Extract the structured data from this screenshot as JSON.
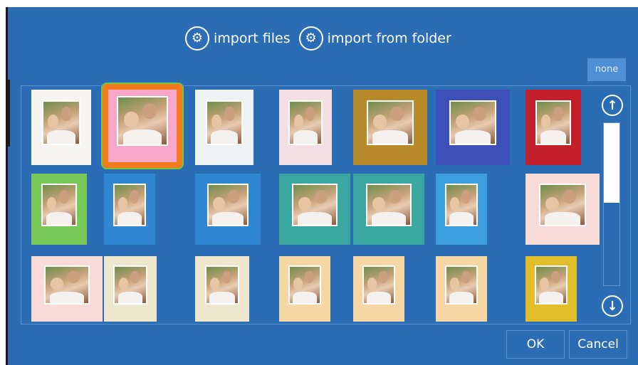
{
  "import": {
    "files_label": "import files",
    "folder_label": "import from folder"
  },
  "none_label": "none",
  "buttons": {
    "ok": "OK",
    "cancel": "Cancel"
  },
  "colors": {
    "dialog_bg": "#2b6db4",
    "selected_frame": "#f27b1d",
    "selected_outline": "#79c34a"
  },
  "templates": {
    "selected_index": 1,
    "rows": [
      [
        "plain",
        "pink-flowers",
        "balloons",
        "tilted-white",
        "gold-christmas",
        "birthday-candles",
        "red-roses"
      ],
      [
        "easter-eggs",
        "blue-circle",
        "blue-circle-wide",
        "teal-pattern",
        "teal-pattern-2",
        "blue-tv",
        "pink-tv"
      ],
      [
        "pink-tv-2",
        "cream-frame",
        "cream-frame-2",
        "pink-giraffe",
        "pink-giraffe-2",
        "pink-giraffe-3",
        "yellow-giraffe"
      ]
    ]
  }
}
